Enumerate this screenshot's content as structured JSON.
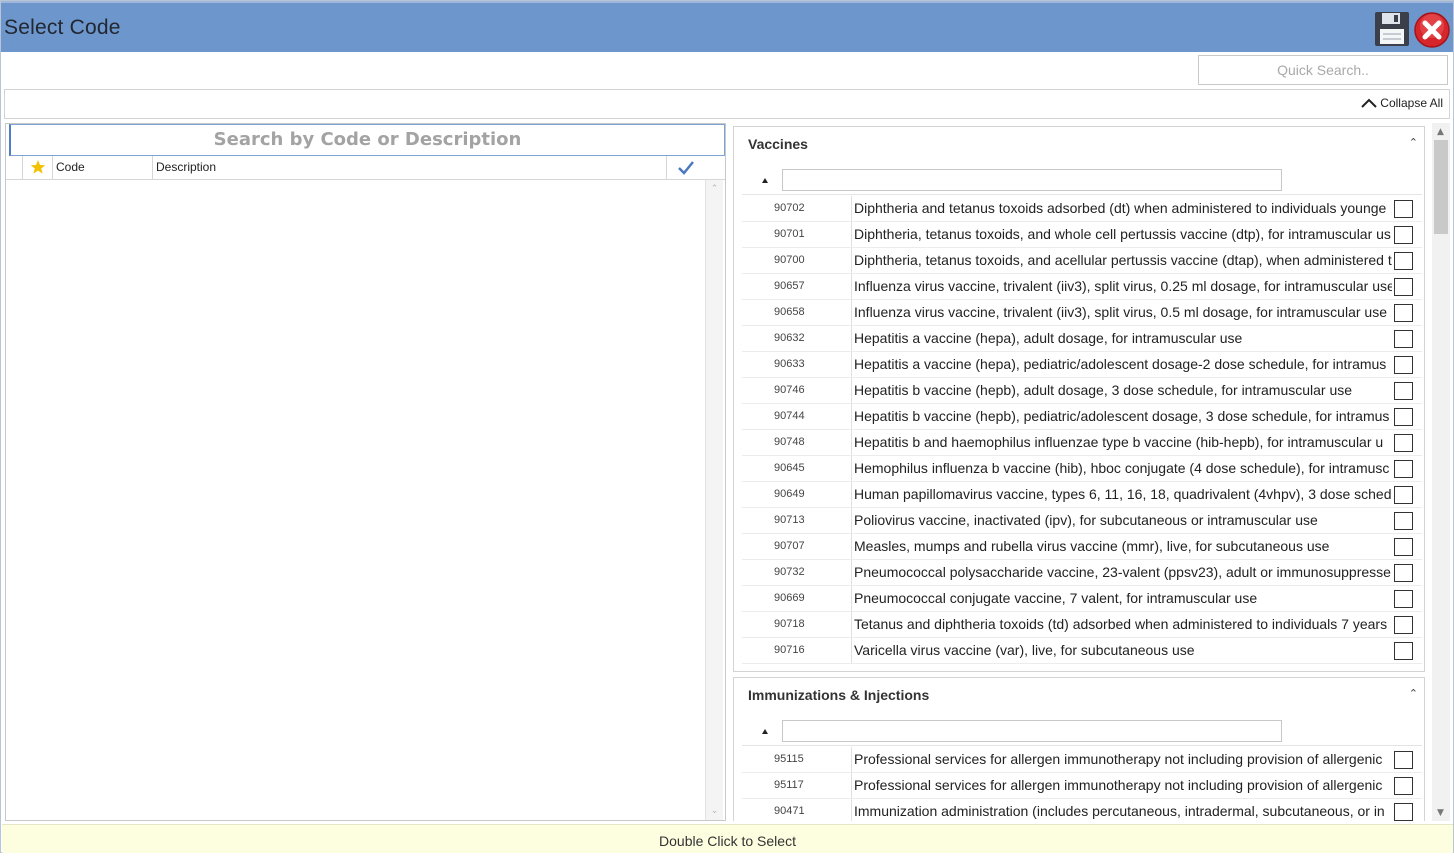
{
  "window": {
    "title": "Select Code"
  },
  "toolbar": {
    "quick_search_placeholder": "Quick Search.."
  },
  "collapse": {
    "label": "Collapse All"
  },
  "left": {
    "search_placeholder": "Search by Code or Description",
    "columns": {
      "code": "Code",
      "description": "Description"
    }
  },
  "groups": [
    {
      "title": "Vaccines",
      "rows": [
        {
          "code": "90702",
          "desc": "Diphtheria and tetanus toxoids adsorbed (dt) when administered to individuals younge"
        },
        {
          "code": "90701",
          "desc": "Diphtheria, tetanus toxoids, and whole cell pertussis vaccine (dtp), for intramuscular us"
        },
        {
          "code": "90700",
          "desc": "Diphtheria, tetanus toxoids, and acellular pertussis vaccine (dtap), when administered t"
        },
        {
          "code": "90657",
          "desc": "Influenza virus vaccine, trivalent (iiv3), split virus, 0.25 ml dosage, for intramuscular use"
        },
        {
          "code": "90658",
          "desc": "Influenza virus vaccine, trivalent (iiv3), split virus, 0.5 ml dosage, for intramuscular use"
        },
        {
          "code": "90632",
          "desc": "Hepatitis a vaccine (hepa), adult dosage, for intramuscular use"
        },
        {
          "code": "90633",
          "desc": "Hepatitis a vaccine (hepa), pediatric/adolescent dosage-2 dose schedule, for intramus"
        },
        {
          "code": "90746",
          "desc": "Hepatitis b vaccine (hepb), adult dosage, 3 dose schedule, for intramuscular use"
        },
        {
          "code": "90744",
          "desc": "Hepatitis b vaccine (hepb), pediatric/adolescent dosage, 3 dose schedule, for intramus"
        },
        {
          "code": "90748",
          "desc": "Hepatitis b and haemophilus influenzae type b vaccine (hib-hepb), for intramuscular u"
        },
        {
          "code": "90645",
          "desc": "Hemophilus influenza b vaccine (hib), hboc conjugate (4 dose schedule), for intramusc"
        },
        {
          "code": "90649",
          "desc": "Human papillomavirus vaccine, types 6, 11, 16, 18, quadrivalent (4vhpv), 3 dose schedu"
        },
        {
          "code": "90713",
          "desc": "Poliovirus vaccine, inactivated (ipv), for subcutaneous or intramuscular use"
        },
        {
          "code": "90707",
          "desc": "Measles, mumps and rubella virus vaccine (mmr), live, for subcutaneous use"
        },
        {
          "code": "90732",
          "desc": "Pneumococcal polysaccharide vaccine, 23-valent (ppsv23), adult or immunosuppresse"
        },
        {
          "code": "90669",
          "desc": "Pneumococcal conjugate vaccine, 7 valent, for intramuscular use"
        },
        {
          "code": "90718",
          "desc": "Tetanus and diphtheria toxoids (td) adsorbed when administered to individuals 7 years"
        },
        {
          "code": "90716",
          "desc": "Varicella virus vaccine (var), live, for subcutaneous use"
        }
      ]
    },
    {
      "title": "Immunizations & Injections",
      "rows": [
        {
          "code": "95115",
          "desc": "Professional services for allergen immunotherapy not including provision of allergenic"
        },
        {
          "code": "95117",
          "desc": "Professional services for allergen immunotherapy not including provision of allergenic"
        },
        {
          "code": "90471",
          "desc": "Immunization administration (includes percutaneous, intradermal, subcutaneous, or in"
        }
      ]
    }
  ],
  "footer": {
    "hint": "Double Click to Select"
  },
  "colors": {
    "titlebar": "#6c96cc",
    "footer": "#fdfde0",
    "check_accent": "#4a78c2",
    "star": "#f2c200"
  }
}
